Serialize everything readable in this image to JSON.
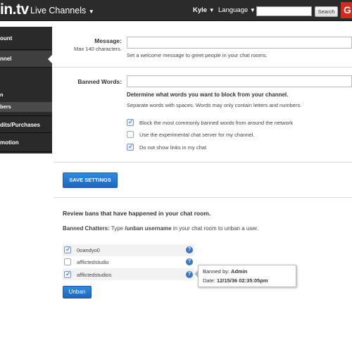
{
  "topbar": {
    "logo": "in.tv",
    "channels_menu": "Live Channels",
    "user": "Kyle",
    "language": "Language",
    "search_placeholder": "",
    "search_label": "Search",
    "red_button": "G"
  },
  "sidebar": {
    "items": [
      {
        "label": "ount"
      },
      {
        "label": "nnel"
      },
      {
        "label": "n"
      },
      {
        "label": "bers"
      },
      {
        "label": "dits/Purchases"
      },
      {
        "label": "motion"
      }
    ]
  },
  "message": {
    "label": "Message:",
    "hint": "Max 140 characters.",
    "value": "",
    "help": "Set a welcome message to greet people in your chat rooms."
  },
  "banned_words": {
    "label": "Banned Words:",
    "value": "",
    "heading": "Determine what words you want to block from your channel.",
    "help": "Separate words with spaces. Words may only contain letters and numbers.",
    "options": [
      {
        "label": "Block the most commonly banned words from around the network",
        "checked": true
      },
      {
        "label": "Use the experimental chat server for my channel.",
        "checked": false
      },
      {
        "label": "Do not show links in my chat",
        "checked": true
      }
    ]
  },
  "save_button": "SAVE SETTINGS",
  "bans": {
    "heading": "Review bans that have happened in your chat room.",
    "chatters_label": "Banned Chatters:",
    "chatters_pre": "Type",
    "chatters_cmd": "/unban username",
    "chatters_post": "in your chat room to unban a user.",
    "rows": [
      {
        "name": "0oandyo0",
        "checked": true
      },
      {
        "name": "afflictedstudio",
        "checked": false
      },
      {
        "name": "afflictedstudios",
        "checked": true
      }
    ],
    "unban_button": "Unban",
    "tooltip": {
      "banned_by_label": "Banned by:",
      "banned_by": "Admin",
      "date_label": "Date:",
      "date": "12/15/36 02:35:05pm"
    }
  }
}
